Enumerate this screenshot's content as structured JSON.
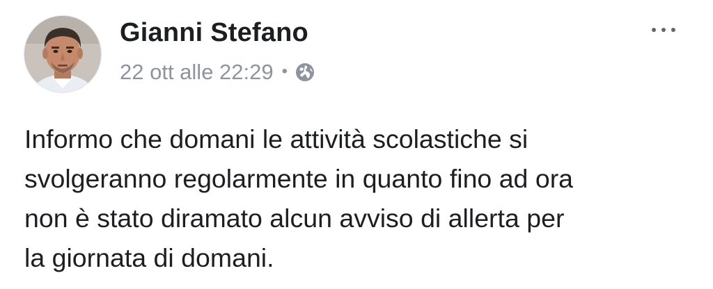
{
  "post": {
    "author": "Gianni Stefano",
    "timestamp": "22 ott alle 22:29",
    "separator": "•",
    "privacy_icon": "globe-icon",
    "more_icon": "more-options-icon",
    "message_lines": [
      "Informo che domani le attività scolastiche si",
      "svolgeranno regolarmente in quanto fino ad ora",
      "non è stato diramato alcun avviso di allerta per",
      "la giornata di domani."
    ]
  },
  "colors": {
    "text_primary": "#1c1e21",
    "text_secondary": "#8d949e",
    "icon": "#606770",
    "background": "#ffffff"
  }
}
